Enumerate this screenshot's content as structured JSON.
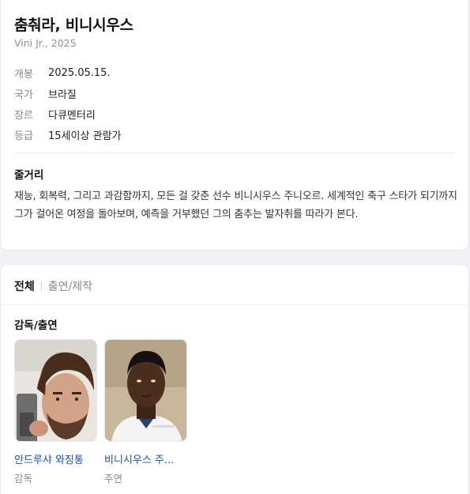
{
  "info": {
    "title": "춤춰라, 비니시우스",
    "subtitle": "Vini Jr., 2025",
    "rows": [
      {
        "label": "개봉",
        "value": "2025.05.15."
      },
      {
        "label": "국가",
        "value": "브라질"
      },
      {
        "label": "장르",
        "value": "다큐멘터리"
      },
      {
        "label": "등급",
        "value": "15세이상 관람가"
      }
    ],
    "synopsis_title": "줄거리",
    "synopsis": "재능, 회복력, 그리고 과감함까지, 모든 걸 갖춘 선수 비니시우스 주니오르. 세계적인 축구 스타가 되기까지 그가 걸어온 여정을 돌아보며, 예측을 거부했던 그의 춤추는 발자취를 따라가 본다."
  },
  "cast": {
    "tabs": [
      {
        "label": "전체",
        "active": true
      },
      {
        "label": "출연/제작",
        "active": false
      }
    ],
    "section_title": "감독/출연",
    "people": [
      {
        "name": "안드루샤 와징통",
        "role": "감독",
        "photo_icon": "director-photo"
      },
      {
        "name": "비니시우스 주...",
        "role": "주연",
        "photo_icon": "lead-actor-photo"
      }
    ]
  },
  "colors": {
    "link": "#1a4fb8",
    "muted": "#8a8a8a",
    "background": "#f1f2f5"
  }
}
